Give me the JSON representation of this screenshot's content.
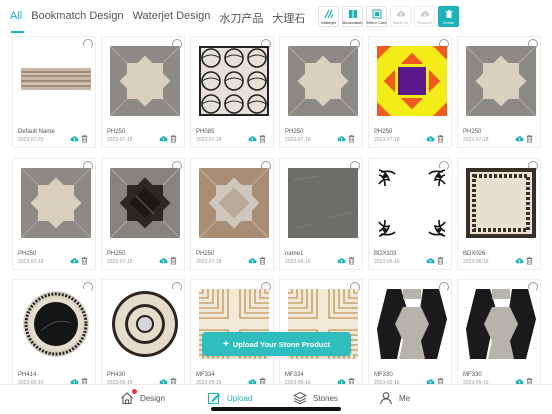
{
  "tabs": [
    "All",
    "Bookmatch Design",
    "Waterjet Design",
    "水刀产品",
    "大理石"
  ],
  "tools": {
    "waterjet": "Waterjet",
    "bookmatch": "Bookmatch",
    "mirror_cant": "Mirror Cant",
    "back_up": "Back Up",
    "recover": "Recover",
    "delete": "Delete"
  },
  "items": [
    {
      "name": "Default Name",
      "date": "2023-07-20",
      "pattern": "marble-strip"
    },
    {
      "name": "PH250",
      "date": "2023-07-18",
      "pattern": "star-grey"
    },
    {
      "name": "PH085",
      "date": "2023-07-18",
      "pattern": "lattice"
    },
    {
      "name": "PH250",
      "date": "2023-07-18",
      "pattern": "star-grey"
    },
    {
      "name": "PH250",
      "date": "2023-07-18",
      "pattern": "star-colored"
    },
    {
      "name": "PH250",
      "date": "2023-07-18",
      "pattern": "star-grey"
    },
    {
      "name": "PH250",
      "date": "2023-07-18",
      "pattern": "star-grey"
    },
    {
      "name": "PH250",
      "date": "2023-07-18",
      "pattern": "star-dark"
    },
    {
      "name": "PH250",
      "date": "2023-07-18",
      "pattern": "star-brown"
    },
    {
      "name": "name1",
      "date": "2023-05-16",
      "pattern": "plain-grey"
    },
    {
      "name": "BDX103",
      "date": "2023-05-16",
      "pattern": "corners"
    },
    {
      "name": "BDX026",
      "date": "2023-05-16",
      "pattern": "border-frame"
    },
    {
      "name": "PH414",
      "date": "2023-05-16",
      "pattern": "circle-dark"
    },
    {
      "name": "PH430",
      "date": "2023-05-16",
      "pattern": "circle-light"
    },
    {
      "name": "MF334",
      "date": "2023-05-16",
      "pattern": "chevron"
    },
    {
      "name": "MF334",
      "date": "2023-05-16",
      "pattern": "chevron"
    },
    {
      "name": "MF330",
      "date": "2023-05-16",
      "pattern": "hex"
    },
    {
      "name": "MF330",
      "date": "2023-05-16",
      "pattern": "hex"
    }
  ],
  "upload_label": "Upload Your Stone Product",
  "nav": {
    "design": "Design",
    "upload": "Upload",
    "stones": "Stones",
    "me": "Me"
  },
  "colors": {
    "accent": "#1ab3b8",
    "badge": "#e53935"
  }
}
